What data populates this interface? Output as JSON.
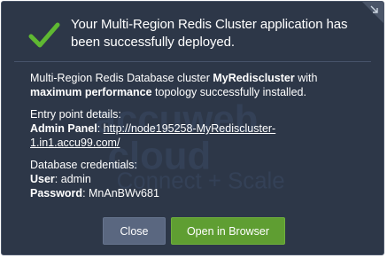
{
  "dialog": {
    "title": "Your Multi-Region Redis Cluster application has been successfully deployed.",
    "status_icon": "check-icon",
    "corner_icon": "collapse-icon",
    "colors": {
      "background": "#2d3748",
      "check": "#5fb832",
      "primary_button": "#5f9e32",
      "secondary_button": "#5a6780"
    }
  },
  "body": {
    "intro_prefix": "Multi-Region Redis Database cluster ",
    "cluster_name": "MyRediscluster",
    "intro_middle": " with ",
    "topology": "maximum performance",
    "intro_suffix": " topology successfully installed.",
    "entry_point_heading": "Entry point details:",
    "admin_panel_label": "Admin Panel",
    "admin_panel_url": "http://node195258-MyRediscluster-1.in1.accu99.com/",
    "credentials_heading": "Database credentials:",
    "user_label": "User",
    "user_value": "admin",
    "password_label": "Password",
    "password_value": "MnAnBWv681"
  },
  "watermark": {
    "line1": "accuweb",
    "line2": "cloud",
    "line3": "Connect + Scale"
  },
  "buttons": {
    "close_label": "Close",
    "open_label": "Open in Browser"
  }
}
